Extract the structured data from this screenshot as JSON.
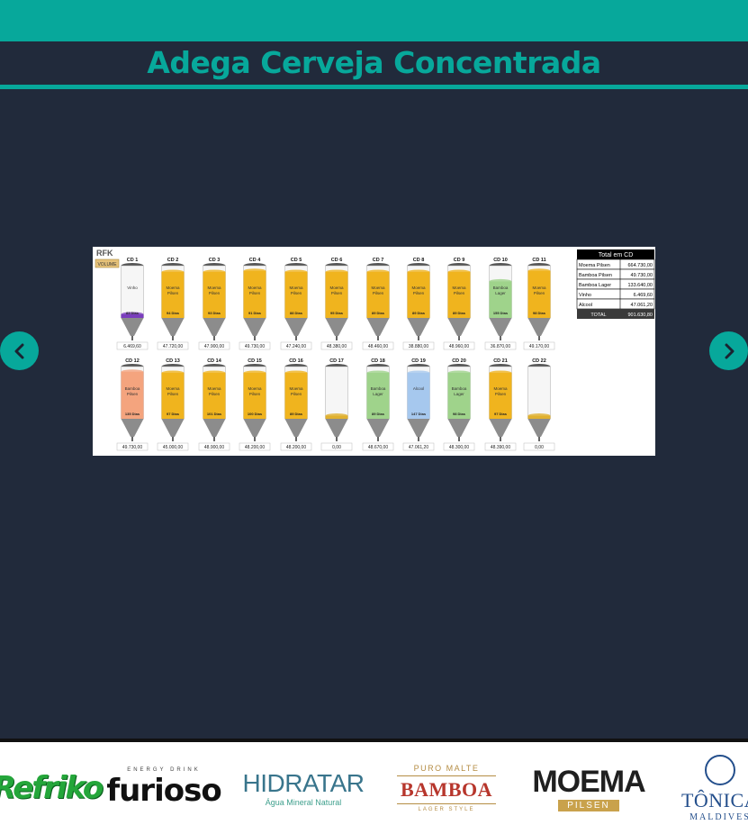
{
  "header": {
    "title": "Adega Cerveja Concentrada"
  },
  "carousel": {
    "prev_icon": "chevron-left-icon",
    "next_icon": "chevron-right-icon",
    "slide": {
      "brand": "RFK",
      "volume_button": "VOLUME",
      "tanks": [
        {
          "id": "CD 1",
          "product": "Vinho",
          "days": "83 Dias",
          "value": "6.469,60",
          "level": 0.07,
          "color": "#7a3dbd"
        },
        {
          "id": "CD 2",
          "product": "Moema Pilsen",
          "days": "94 Dias",
          "value": "47.720,00",
          "level": 0.88,
          "color": "#f0b41e"
        },
        {
          "id": "CD 3",
          "product": "Moema Pilsen",
          "days": "93 Dias",
          "value": "47.900,00",
          "level": 0.88,
          "color": "#f0b41e"
        },
        {
          "id": "CD 4",
          "product": "Moema Pilsen",
          "days": "91 Dias",
          "value": "49.730,00",
          "level": 0.9,
          "color": "#f0b41e"
        },
        {
          "id": "CD 5",
          "product": "Moema Pilsen",
          "days": "88 Dias",
          "value": "47.240,00",
          "level": 0.88,
          "color": "#f0b41e"
        },
        {
          "id": "CD 6",
          "product": "Moema Pilsen",
          "days": "95 Dias",
          "value": "48.380,00",
          "level": 0.88,
          "color": "#f0b41e"
        },
        {
          "id": "CD 7",
          "product": "Moema Pilsen",
          "days": "89 Dias",
          "value": "48.460,00",
          "level": 0.88,
          "color": "#f0b41e"
        },
        {
          "id": "CD 8",
          "product": "Moema Pilsen",
          "days": "89 Dias",
          "value": "38.880,00",
          "level": 0.88,
          "color": "#f0b41e"
        },
        {
          "id": "CD 9",
          "product": "Moema Pilsen",
          "days": "89 Dias",
          "value": "48.960,00",
          "level": 0.88,
          "color": "#f0b41e"
        },
        {
          "id": "CD 10",
          "product": "Bamboa Lager",
          "days": "155 Dias",
          "value": "36.870,00",
          "level": 0.7,
          "color": "#9fd38b"
        },
        {
          "id": "CD 11",
          "product": "Moema Pilsen",
          "days": "98 Dias",
          "value": "49.170,00",
          "level": 0.9,
          "color": "#f0b41e"
        },
        {
          "id": "CD 12",
          "product": "Bamboa Pilsen",
          "days": "135 Dias",
          "value": "49.730,00",
          "level": 0.9,
          "color": "#f4a47e"
        },
        {
          "id": "CD 13",
          "product": "Moema Pilsen",
          "days": "97 Dias",
          "value": "45.000,00",
          "level": 0.88,
          "color": "#f0b41e"
        },
        {
          "id": "CD 14",
          "product": "Moema Pilsen",
          "days": "101 Dias",
          "value": "48.900,00",
          "level": 0.88,
          "color": "#f0b41e"
        },
        {
          "id": "CD 15",
          "product": "Moema Pilsen",
          "days": "100 Dias",
          "value": "48.200,00",
          "level": 0.88,
          "color": "#f0b41e"
        },
        {
          "id": "CD 16",
          "product": "Moema Pilsen",
          "days": "89 Dias",
          "value": "48.200,00",
          "level": 0.88,
          "color": "#f0b41e"
        },
        {
          "id": "CD 17",
          "product": "",
          "days": "",
          "value": "0,00",
          "level": 0.06,
          "color": "#e0b030"
        },
        {
          "id": "CD 18",
          "product": "Bamboa Lager",
          "days": "89 Dias",
          "value": "48.670,00",
          "level": 0.88,
          "color": "#9fd38b"
        },
        {
          "id": "CD 19",
          "product": "Alcool",
          "days": "147 Dias",
          "value": "47.061,20",
          "level": 0.88,
          "color": "#a6c8ee"
        },
        {
          "id": "CD 20",
          "product": "Bamboa Lager",
          "days": "98 Dias",
          "value": "48.300,00",
          "level": 0.88,
          "color": "#9fd38b"
        },
        {
          "id": "CD 21",
          "product": "Moema Pilsen",
          "days": "97 Dias",
          "value": "48.390,00",
          "level": 0.88,
          "color": "#f0b41e"
        },
        {
          "id": "CD 22",
          "product": "",
          "days": "",
          "value": "0,00",
          "level": 0.06,
          "color": "#e0b030"
        }
      ],
      "totals": {
        "title": "Total em CD",
        "rows": [
          {
            "label": "Moema Pilsen",
            "value": "664.730,00"
          },
          {
            "label": "Bamboa Pilsen",
            "value": "49.730,00"
          },
          {
            "label": "Bamboa Lager",
            "value": "133.640,00"
          },
          {
            "label": "Vinho",
            "value": "6.469,60"
          },
          {
            "label": "Alcool",
            "value": "47.061,20"
          }
        ],
        "total_label": "TOTAL",
        "total_value": "901.630,80"
      }
    }
  },
  "logos": [
    {
      "name": "Refriko",
      "text": "Refriko"
    },
    {
      "name": "Furioso",
      "top": "ENERGY DRINK",
      "text": "furioso"
    },
    {
      "name": "Hidratar",
      "text": "HIDRATAR",
      "sub": "Água Mineral Natural"
    },
    {
      "name": "Bamboa",
      "top": "PURO MALTE",
      "text": "BAMBOA",
      "sub": "LAGER STYLE"
    },
    {
      "name": "Moema",
      "text": "MOEMA",
      "sub": "PILSEN"
    },
    {
      "name": "Tonica",
      "text": "TÔNICA",
      "sub": "MALDIVES"
    }
  ],
  "colors": {
    "accent": "#07a89b",
    "background": "#212a3b"
  }
}
